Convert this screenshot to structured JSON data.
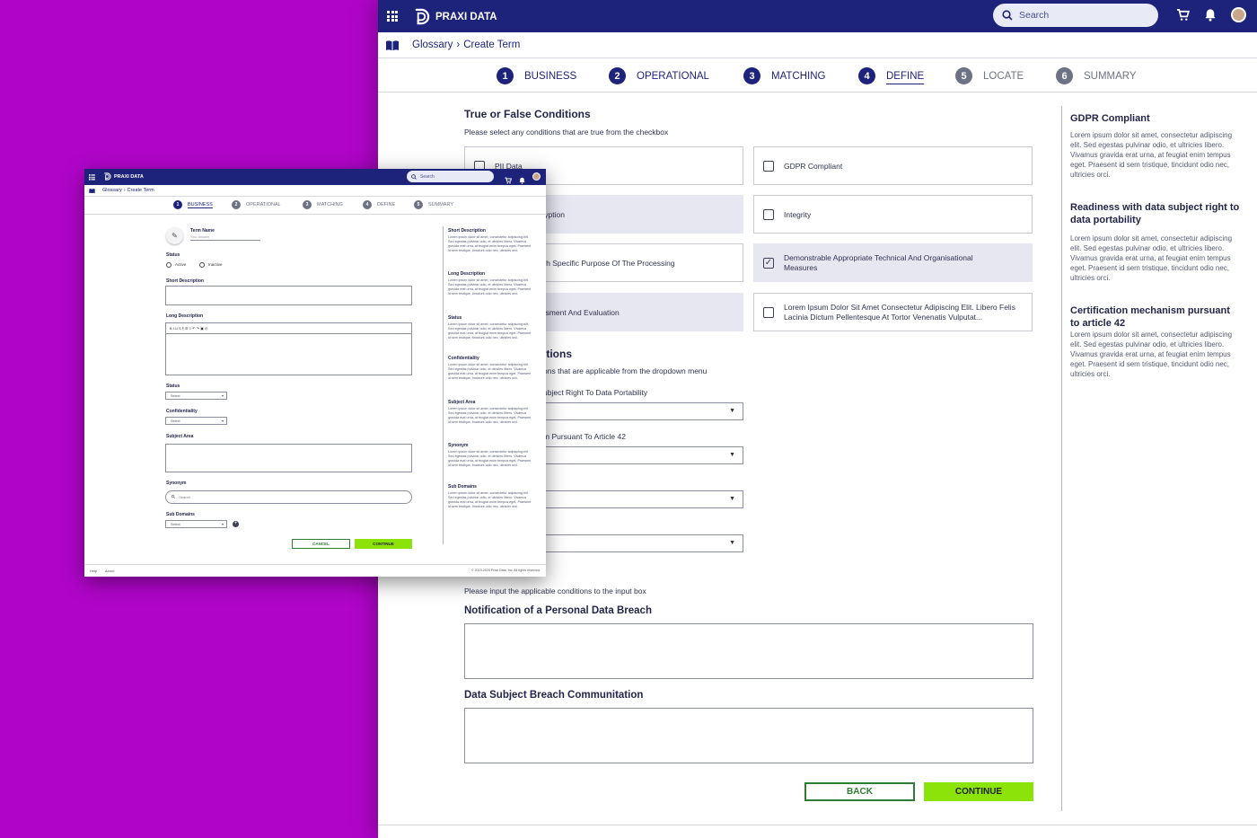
{
  "app": {
    "brand": "PRAXI DATA",
    "search_placeholder": "Search"
  },
  "breadcrumb": {
    "root": "Glossary",
    "sep": "›",
    "current": "Create Term"
  },
  "steps_big": [
    {
      "num": "1",
      "label": "BUSINESS",
      "state": "done"
    },
    {
      "num": "2",
      "label": "OPERATIONAL",
      "state": "done"
    },
    {
      "num": "3",
      "label": "MATCHING",
      "state": "done"
    },
    {
      "num": "4",
      "label": "DEFINE",
      "state": "active"
    },
    {
      "num": "5",
      "label": "LOCATE",
      "state": "future"
    },
    {
      "num": "6",
      "label": "SUMMARY",
      "state": "future"
    }
  ],
  "define": {
    "tf_title": "True or False Conditions",
    "tf_sub": "Please select any conditions that are true from the checkbox",
    "checkboxes": [
      {
        "label": "PII Data",
        "checked": false,
        "shaded": false
      },
      {
        "label": "GDPR Compliant",
        "checked": false,
        "shaded": false
      },
      {
        "label": "ation And Encryption",
        "checked": false,
        "shaded": true
      },
      {
        "label": "Integrity",
        "checked": false,
        "shaded": false
      },
      {
        "label": "essary For Each Specific Purpose Of The Processing",
        "checked": false,
        "shaded": false
      },
      {
        "label": "Demonstrable Appropriate Technical And Organisational Measures",
        "checked": true,
        "shaded": true
      },
      {
        "label": "rity Test, Assessment And Evaluation",
        "checked": false,
        "shaded": true
      },
      {
        "label": "Lorem Ipsum Dolor Sit Amet Consectetur Adipiscing Elit. Libero Felis Lacinia Dictum Pellentesque At Tortor Venenatis Vulputat...",
        "checked": false,
        "shaded": false
      }
    ],
    "dd_title": "itions",
    "dd_sub": "ons that are applicable from the dropdown menu",
    "dropdowns": [
      {
        "label": "ubject Right To Data Portability"
      },
      {
        "label": "m Pursuant To Article 42"
      },
      {
        "label": ""
      },
      {
        "label": ""
      }
    ],
    "input_sub": "Please input the applicable conditions to the input box",
    "breach_label": "Notification of a Personal Data Breach",
    "comm_label": "Data Subject Breach Communitation",
    "back": "BACK",
    "continue": "CONTINUE"
  },
  "right_panel": [
    {
      "title": "GDPR Compliant",
      "text": "Lorem ipsum dolor sit amet, consectetur adipiscing elit. Sed egestas pulvinar odio, et ultricies libero. Vivamus gravida erat urna, at feugiat enim tempus eget. Praesent id sem tristique, tincidunt odio nec, ultricies orci."
    },
    {
      "title": "Readiness with data subject right to data portability",
      "text": "Lorem ipsum dolor sit amet, consectetur adipiscing elit. Sed egestas pulvinar odio, et ultricies libero. Vivamus gravida erat urna, at feugiat enim tempus eget. Praesent id sem tristique, tincidunt odio nec, ultricies orci."
    },
    {
      "title": "Certification mechanism pursuant to article 42",
      "text": "Lorem ipsum dolor sit amet, consectetur adipiscing elit. Sed egestas pulvinar odio, et ultricies libero. Vivamus gravida erat urna, at feugiat enim tempus eget. Praesent id sem tristique, tincidunt odio nec, ultricies orci."
    }
  ],
  "small": {
    "steps": [
      {
        "num": "1",
        "label": "BUSINESS",
        "state": "active"
      },
      {
        "num": "2",
        "label": "OPERATIONAL",
        "state": "future"
      },
      {
        "num": "3",
        "label": "MATCHING",
        "state": "future"
      },
      {
        "num": "4",
        "label": "DEFINE",
        "state": "future"
      },
      {
        "num": "5",
        "label": "SUMMARY",
        "state": "future"
      }
    ],
    "term_name_label": "Term Name",
    "term_name_placeholder": "Your Answer",
    "status_label": "Status",
    "active": "Active",
    "inactive": "Inactive",
    "short_desc_label": "Short Description",
    "long_desc_label": "Long Description",
    "status2_label": "Status",
    "confidentiality_label": "Confidentiality",
    "select": "Select",
    "subject_area_label": "Subject Area",
    "synonym_label": "Synonym",
    "synonym_placeholder": "Search",
    "sub_domains_label": "Sub Domains",
    "cancel": "CANCEL",
    "continue": "CONTINUE",
    "help": "Help",
    "about": "About",
    "copyright": "© 2019-2020 Praxi Data, Inc. All rights reserved.",
    "toolbar": "B  I  U  S  ¶  ☰  ≡  ↶  ↷  ▣  ◎",
    "right": [
      {
        "title": "Short Description",
        "text": "Lorem ipsum dolor sit amet, consectetur adipiscing elit. Sed egestas pulvinar odio, et ultricies libero. Vivamus gravida erat urna, at feugiat enim tempus eget. Praesent id sem tristique, tincidunt odio nec, ultricies orci."
      },
      {
        "title": "Long Description",
        "text": "Lorem ipsum dolor sit amet, consectetur adipiscing elit. Sed egestas pulvinar odio, et ultricies libero. Vivamus gravida erat urna, at feugiat enim tempus eget. Praesent id sem tristique, tincidunt odio nec, ultricies orci."
      },
      {
        "title": "Status",
        "text": "Lorem ipsum dolor sit amet, consectetur adipiscing elit. Sed egestas pulvinar odio, et ultricies libero. Vivamus gravida erat urna, at feugiat enim tempus eget. Praesent id sem tristique, tincidunt odio nec, ultricies orci."
      },
      {
        "title": "Confidentiality",
        "text": "Lorem ipsum dolor sit amet, consectetur adipiscing elit. Sed egestas pulvinar odio, et ultricies libero. Vivamus gravida erat urna, at feugiat enim tempus eget. Praesent id sem tristique, tincidunt odio nec, ultricies orci."
      },
      {
        "title": "Subject Area",
        "text": "Lorem ipsum dolor sit amet, consectetur adipiscing elit. Sed egestas pulvinar odio, et ultricies libero. Vivamus gravida erat urna, at feugiat enim tempus eget. Praesent id sem tristique, tincidunt odio nec, ultricies orci."
      },
      {
        "title": "Synonym",
        "text": "Lorem ipsum dolor sit amet, consectetur adipiscing elit. Sed egestas pulvinar odio, et ultricies libero. Vivamus gravida erat urna, at feugiat enim tempus eget. Praesent id sem tristique, tincidunt odio nec, ultricies orci."
      },
      {
        "title": "Sub Domains",
        "text": "Lorem ipsum dolor sit amet, consectetur adipiscing elit. Sed egestas pulvinar odio, et ultricies libero. Vivamus gravida erat urna, at feugiat enim tempus eget. Praesent id sem tristique, tincidunt odio nec, ultricies orci."
      }
    ]
  },
  "colors": {
    "navy": "#1d237a",
    "accent_green": "#8be30a",
    "background": "#b005c9"
  }
}
